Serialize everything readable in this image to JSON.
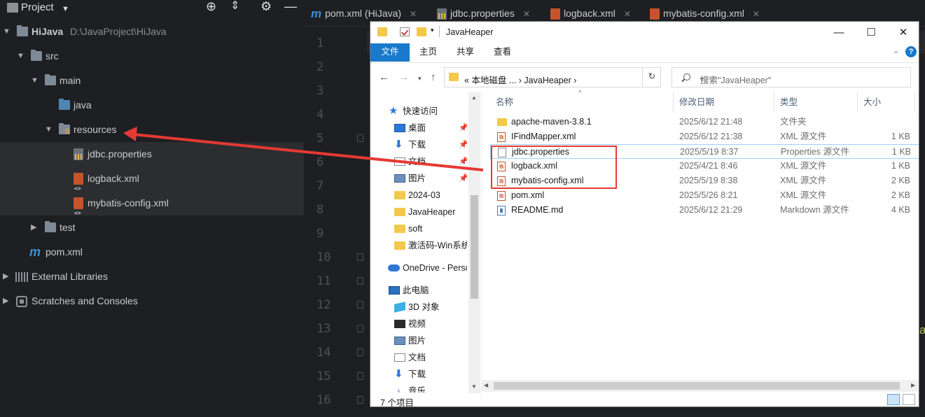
{
  "ide": {
    "project_panel": {
      "title": "Project",
      "tree": [
        {
          "label": "HiJava",
          "path": "D:\\JavaProject\\HiJava"
        },
        {
          "label": "src"
        },
        {
          "label": "main"
        },
        {
          "label": "java"
        },
        {
          "label": "resources"
        },
        {
          "label": "jdbc.properties"
        },
        {
          "label": "logback.xml"
        },
        {
          "label": "mybatis-config.xml"
        },
        {
          "label": "test"
        },
        {
          "label": "pom.xml"
        },
        {
          "label": "External Libraries"
        },
        {
          "label": "Scratches and Consoles"
        }
      ]
    },
    "tabs": [
      {
        "label": "pom.xml (HiJava)"
      },
      {
        "label": "jdbc.properties"
      },
      {
        "label": "logback.xml"
      },
      {
        "label": "mybatis-config.xml"
      }
    ],
    "line_numbers": [
      "1",
      "2",
      "3",
      "4",
      "5",
      "6",
      "7",
      "8",
      "9",
      "10",
      "11",
      "12",
      "13",
      "14",
      "15",
      "16"
    ],
    "edge_text": "a"
  },
  "explorer": {
    "title": "JavaHeaper",
    "ribbon_tabs": [
      "文件",
      "主页",
      "共享",
      "查看"
    ],
    "address": "«  本地磁盘 ...  ›  JavaHeaper  ›",
    "search_placeholder": "搜索\"JavaHeaper\"",
    "nav_items": [
      {
        "label": "快速访问",
        "icon": "star-icon"
      },
      {
        "label": "桌面",
        "icon": "desktop-icon",
        "pinned": true
      },
      {
        "label": "下载",
        "icon": "download-icon",
        "pinned": true
      },
      {
        "label": "文档",
        "icon": "document-icon",
        "pinned": true
      },
      {
        "label": "图片",
        "icon": "picture-icon",
        "pinned": true
      },
      {
        "label": "2024-03",
        "icon": "folder-icon"
      },
      {
        "label": "JavaHeaper",
        "icon": "folder-icon"
      },
      {
        "label": "soft",
        "icon": "folder-icon"
      },
      {
        "label": "激活码-Win系统",
        "icon": "folder-icon"
      },
      {
        "label": "OneDrive - Perso",
        "icon": "cloud-icon"
      },
      {
        "label": "此电脑",
        "icon": "computer-icon"
      },
      {
        "label": "3D 对象",
        "icon": "cube-icon"
      },
      {
        "label": "视频",
        "icon": "video-icon"
      },
      {
        "label": "图片",
        "icon": "picture-icon"
      },
      {
        "label": "文档",
        "icon": "document-icon"
      },
      {
        "label": "下载",
        "icon": "download-icon"
      },
      {
        "label": "音乐",
        "icon": "music-icon"
      }
    ],
    "columns": [
      "名称",
      "修改日期",
      "类型",
      "大小"
    ],
    "files": [
      {
        "name": "apache-maven-3.8.1",
        "date": "2025/6/12 21:48",
        "type": "文件夹",
        "size": "",
        "kind": "dir"
      },
      {
        "name": "IFindMapper.xml",
        "date": "2025/6/12 21:38",
        "type": "XML 源文件",
        "size": "1 KB",
        "kind": "xml"
      },
      {
        "name": "jdbc.properties",
        "date": "2025/5/19 8:37",
        "type": "Properties 源文件",
        "size": "1 KB",
        "kind": "txt"
      },
      {
        "name": "logback.xml",
        "date": "2025/4/21 8:46",
        "type": "XML 源文件",
        "size": "1 KB",
        "kind": "xml"
      },
      {
        "name": "mybatis-config.xml",
        "date": "2025/5/19 8:38",
        "type": "XML 源文件",
        "size": "2 KB",
        "kind": "xml"
      },
      {
        "name": "pom.xml",
        "date": "2025/5/26 8:21",
        "type": "XML 源文件",
        "size": "2 KB",
        "kind": "xml"
      },
      {
        "name": "README.md",
        "date": "2025/6/12 21:29",
        "type": "Markdown 源文件",
        "size": "4 KB",
        "kind": "md"
      }
    ],
    "status": "7 个项目"
  },
  "colors": {
    "ide_bg": "#1e1f22",
    "selection": "#2b2d30",
    "annotation_red": "#e53935",
    "ribbon_active": "#1979ca"
  }
}
